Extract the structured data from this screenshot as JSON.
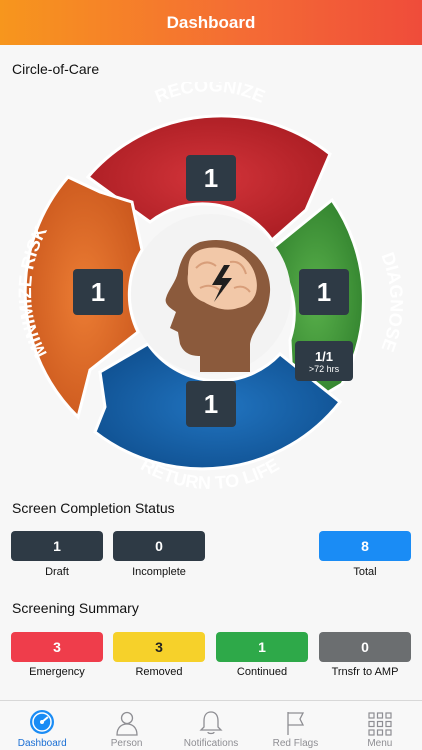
{
  "header": {
    "title": "Dashboard"
  },
  "circle": {
    "title": "Circle-of-Care",
    "segments": {
      "recognize": {
        "label": "RECOGNIZE",
        "count": "1",
        "color": "#c0272d"
      },
      "diagnose": {
        "label": "DIAGNOSE",
        "count": "1",
        "color": "#3f9a3a",
        "sub_count": "1/1",
        "sub_text": ">72 hrs"
      },
      "return_to_life": {
        "label": "RETURN TO LIFE",
        "count": "1",
        "color": "#1560a8"
      },
      "minimize_risk": {
        "label": "MINIMIZE RISK",
        "count": "1",
        "color": "#e06a26"
      }
    },
    "center_icon": "head-brain-lightning-icon"
  },
  "completion": {
    "title": "Screen Completion Status",
    "items": [
      {
        "value": "1",
        "label": "Draft",
        "color": "#2e3a45"
      },
      {
        "value": "0",
        "label": "Incomplete",
        "color": "#2e3a45"
      },
      {
        "value": "8",
        "label": "Total",
        "color": "#1a8cf5"
      }
    ]
  },
  "summary": {
    "title": "Screening Summary",
    "items": [
      {
        "value": "3",
        "label": "Emergency",
        "color": "#ef3d4b"
      },
      {
        "value": "3",
        "label": "Removed",
        "color": "#f6d12a"
      },
      {
        "value": "1",
        "label": "Continued",
        "color": "#2ea949"
      },
      {
        "value": "0",
        "label": "Trnsfr to AMP",
        "color": "#6b6e70"
      }
    ]
  },
  "tabs": [
    {
      "label": "Dashboard",
      "icon": "speedometer-icon",
      "active": true
    },
    {
      "label": "Person",
      "icon": "person-icon",
      "active": false
    },
    {
      "label": "Notifications",
      "icon": "bell-icon",
      "active": false
    },
    {
      "label": "Red Flags",
      "icon": "flag-icon",
      "active": false
    },
    {
      "label": "Menu",
      "icon": "grid-icon",
      "active": false
    }
  ]
}
